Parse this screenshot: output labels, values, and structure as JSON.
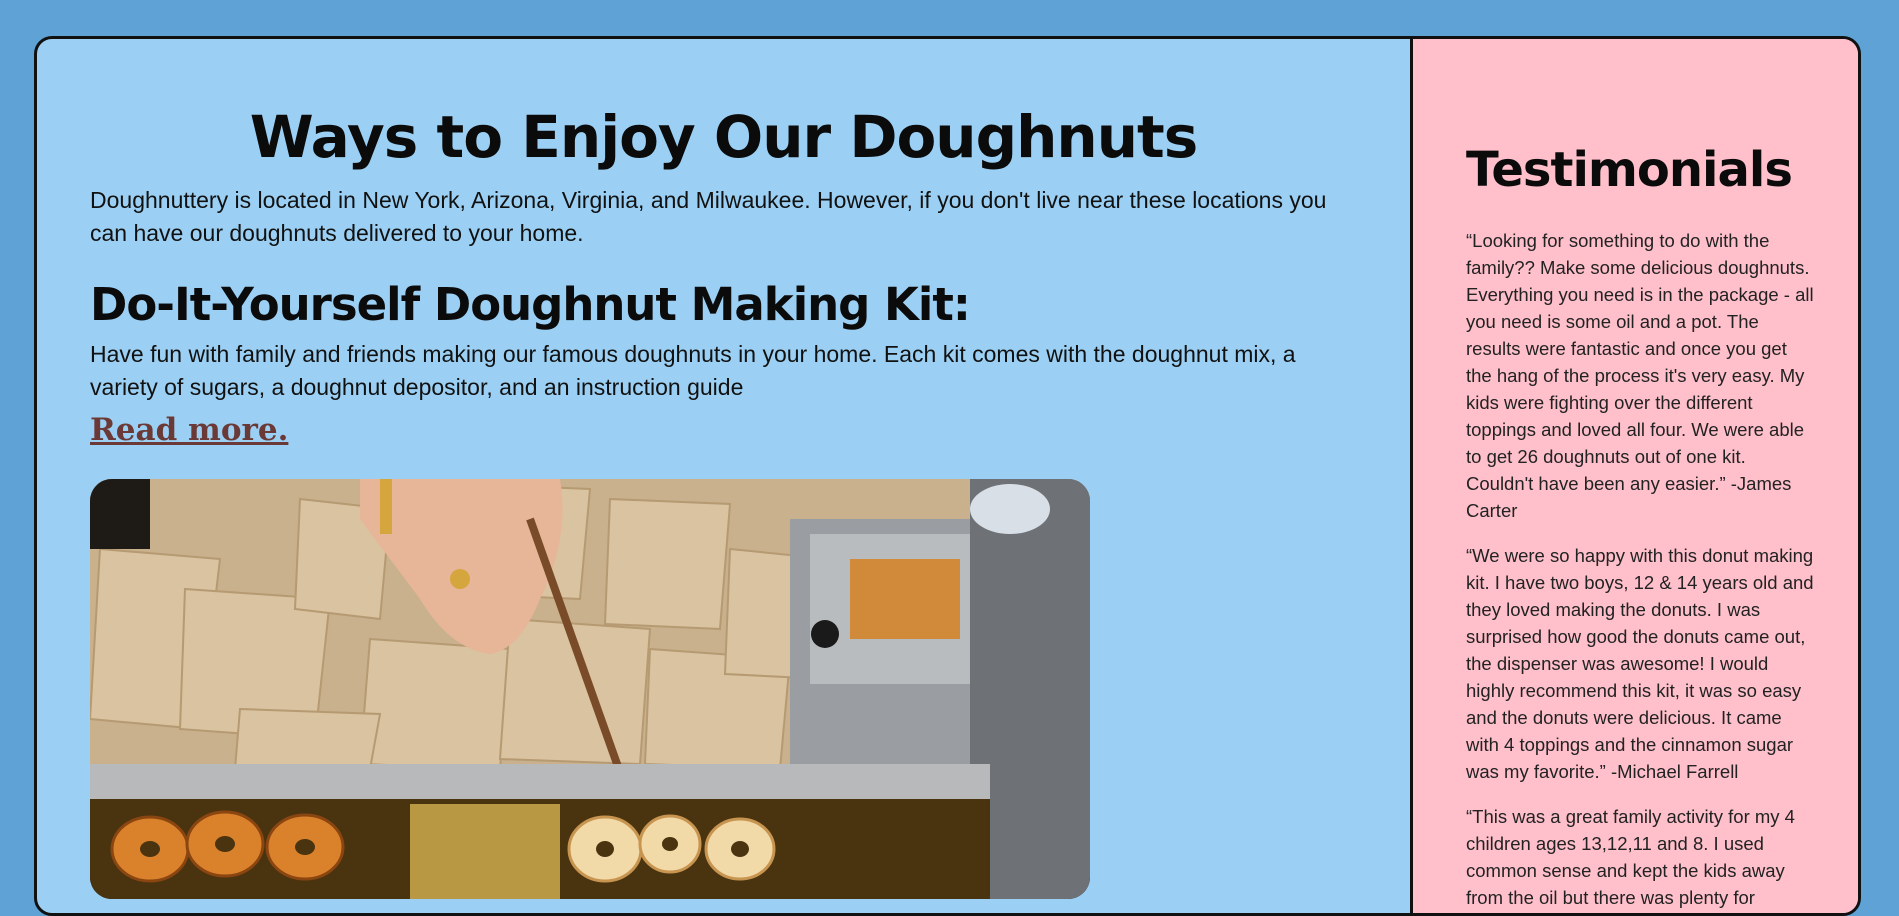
{
  "main": {
    "title": "Ways to Enjoy Our Doughnuts",
    "intro": "Doughnuttery is located in New York, Arizona, Virginia, and Milwaukee. However, if you don't live near these locations you can have our doughnuts delivered to your home.",
    "kit_title": "Do-It-Yourself Doughnut Making Kit:",
    "kit_desc": "Have fun with family and friends making our famous doughnuts in your home. Each kit comes with the doughnut mix, a variety of sugars, a doughnut depositor, and an instruction guide",
    "read_more": "Read more."
  },
  "sidebar": {
    "title": "Testimonials",
    "testimonials": [
      "“Looking for something to do with the family?? Make some delicious doughnuts. Everything you need is in the package - all you need is some oil and a pot. The results were fantastic and once you get the hang of the process it's very easy. My kids were fighting over the different toppings and loved all four. We were able to get 26 doughnuts out of one kit. Couldn't have been any easier.” -James Carter",
      "“We were so happy with this donut making kit. I have two boys, 12 & 14 years old and they loved making the donuts. I was surprised how good the donuts came out, the dispenser was awesome! I would highly recommend this kit, it was so easy and the donuts were delicious. It came with 4 toppings and the cinnamon sugar was my favorite.” -Michael Farrell",
      "“This was a great family activity for my 4 children ages 13,12,11 and 8. I used common sense and kept the kids away from the oil but there was plenty for"
    ]
  }
}
